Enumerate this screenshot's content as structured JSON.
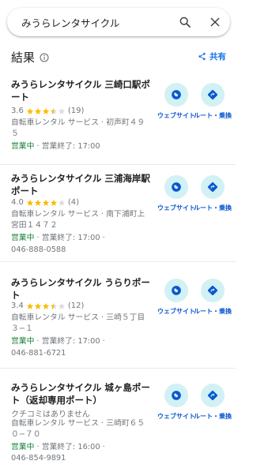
{
  "search": {
    "value": "みうらレンタサイクル"
  },
  "header": {
    "title": "結果",
    "share_label": "共有"
  },
  "actions": {
    "website_label": "ウェブサイト",
    "route_label": "ルート・乗換"
  },
  "results": [
    {
      "name": "みうらレンタサイクル 三崎口駅ポート",
      "rating": "3.6",
      "stars": 3.5,
      "reviews": "(19)",
      "lines": [
        "自転車レンタル サービス · 初声町４９５"
      ],
      "status_open": "営業中",
      "status_rest": " · 営業終了: 17:00",
      "phone": ""
    },
    {
      "name": "みうらレンタサイクル 三浦海岸駅ポート",
      "rating": "4.0",
      "stars": 4,
      "reviews": "(4)",
      "lines": [
        "自転車レンタル サービス · 南下浦町上宮田１４７２"
      ],
      "status_open": "営業中",
      "status_rest": " · 営業終了: 17:00 ·",
      "phone": "046-888-0588"
    },
    {
      "name": "みうらレンタサイクル うらりポート",
      "rating": "3.4",
      "stars": 3.5,
      "reviews": "(12)",
      "lines": [
        "自転車レンタル サービス · 三崎５丁目３−１"
      ],
      "status_open": "営業中",
      "status_rest": " · 営業終了: 17:00 ·",
      "phone": "046-881-6721"
    },
    {
      "name": "みうらレンタサイクル 城ヶ島ポート（返却専用ポート）",
      "no_reviews": "クチコミはありません",
      "lines": [
        "自転車レンタル サービス · 三崎町６５０−７０"
      ],
      "status_open": "営業中",
      "status_rest": " · 営業終了: 16:00 ·",
      "phone": "046-854-9891"
    }
  ],
  "colors": {
    "accent": "#1a73e8",
    "open": "#188038",
    "action_bg": "#d2f1f5",
    "star": "#fbbc04"
  }
}
